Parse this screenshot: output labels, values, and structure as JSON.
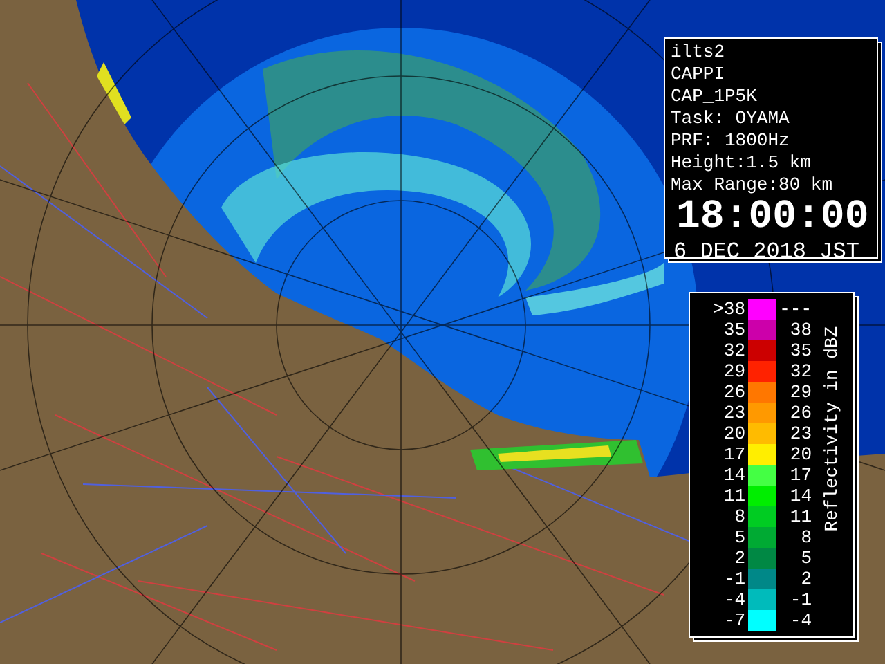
{
  "radar_info": {
    "lines": [
      "ilts2",
      "CAPPI",
      "CAP_1P5K",
      "Task: OYAMA",
      "PRF: 1800Hz",
      "Height:1.5 km",
      "Max Range:80 km"
    ],
    "time": "18:00:00",
    "date": "6 DEC 2018 JST"
  },
  "legend": {
    "title": "Reflectivity in dBZ",
    "rows": [
      {
        "low": ">38",
        "high": "---",
        "color": "#ff00ff"
      },
      {
        "low": "35",
        "high": "38",
        "color": "#cc00aa"
      },
      {
        "low": "32",
        "high": "35",
        "color": "#cc0000"
      },
      {
        "low": "29",
        "high": "32",
        "color": "#ff2200"
      },
      {
        "low": "26",
        "high": "29",
        "color": "#ff7700"
      },
      {
        "low": "23",
        "high": "26",
        "color": "#ff9900"
      },
      {
        "low": "20",
        "high": "23",
        "color": "#ffbb00"
      },
      {
        "low": "17",
        "high": "20",
        "color": "#ffee00"
      },
      {
        "low": "14",
        "high": "17",
        "color": "#44ff44"
      },
      {
        "low": "11",
        "high": "14",
        "color": "#00ee00"
      },
      {
        "low": "8",
        "high": "11",
        "color": "#00cc22"
      },
      {
        "low": "5",
        "high": "8",
        "color": "#00aa33"
      },
      {
        "low": "2",
        "high": "5",
        "color": "#008844"
      },
      {
        "low": "-1",
        "high": "2",
        "color": "#008888"
      },
      {
        "low": "-4",
        "high": "-1",
        "color": "#00bbbb"
      },
      {
        "low": "-7",
        "high": "-4",
        "color": "#00ffff"
      }
    ]
  }
}
